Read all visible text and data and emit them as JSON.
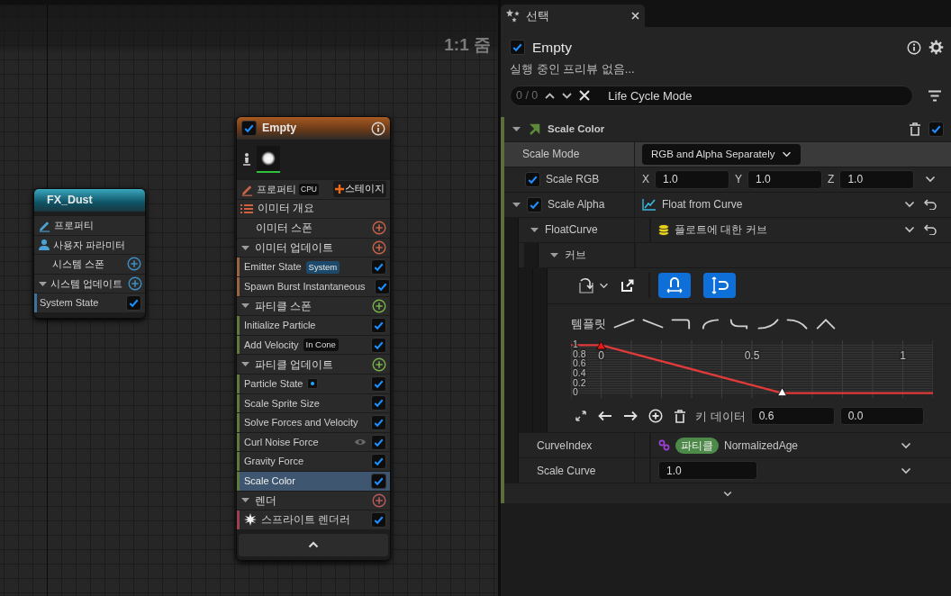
{
  "graph": {
    "zoom_label": "1:1 줌",
    "nodes": [
      {
        "kind": "system",
        "title": "FX_Dust",
        "rows": [
          {
            "kind": "properties",
            "label": "프로퍼티"
          },
          {
            "kind": "user_parameters",
            "label": "사용자 파라미터"
          },
          {
            "kind": "stage",
            "label": "시스템 스폰",
            "color": "#3d8ec4"
          },
          {
            "kind": "group",
            "label": "시스템 업데이트",
            "expanded": true,
            "color": "#3d8ec4"
          },
          {
            "kind": "module",
            "label": "System State",
            "checked": true,
            "selected": false,
            "color": "#3d7299"
          }
        ]
      },
      {
        "kind": "emitter",
        "title": "Empty",
        "checked": true,
        "rows": [
          {
            "kind": "properties",
            "label": "프로퍼티",
            "sim_target": "CPU",
            "add_button": "스테이지"
          },
          {
            "kind": "summary",
            "label": "이미터 개요"
          },
          {
            "kind": "stage",
            "label": "이미터 스폰",
            "color": "#c8634a"
          },
          {
            "kind": "group",
            "label": "이미터 업데이트",
            "expanded": true,
            "color": "#c8634a"
          },
          {
            "kind": "module",
            "label": "Emitter State",
            "badge": "System",
            "checked": true,
            "selected": false,
            "color": "#9a6440"
          },
          {
            "kind": "module",
            "label": "Spawn Burst Instantaneous",
            "checked": true,
            "selected": false,
            "color": "#9a6440"
          },
          {
            "kind": "group",
            "label": "파티클 스폰",
            "expanded": true,
            "color": "#7ab04a"
          },
          {
            "kind": "module",
            "label": "Initialize Particle",
            "checked": true,
            "selected": false,
            "color": "#5f7a3a"
          },
          {
            "kind": "module",
            "label": "Add Velocity",
            "badge": "In Cone",
            "checked": true,
            "selected": false,
            "color": "#5f7a3a"
          },
          {
            "kind": "group",
            "label": "파티클 업데이트",
            "expanded": true,
            "color": "#7ab04a"
          },
          {
            "kind": "dotmodule",
            "label": "Particle State",
            "checked": true,
            "selected": false,
            "color": "#5f7a3a"
          },
          {
            "kind": "module",
            "label": "Scale Sprite Size",
            "checked": true,
            "selected": false,
            "color": "#5f7a3a"
          },
          {
            "kind": "module",
            "label": "Solve Forces and Velocity",
            "checked": true,
            "selected": false,
            "color": "#5f7a3a"
          },
          {
            "kind": "eyemodule",
            "label": "Curl Noise Force",
            "checked": true,
            "selected": false,
            "color": "#5f7a3a"
          },
          {
            "kind": "module",
            "label": "Gravity Force",
            "checked": true,
            "selected": false,
            "color": "#5f7a3a"
          },
          {
            "kind": "module",
            "label": "Scale Color",
            "checked": true,
            "selected": true,
            "color": "#5f7a3a"
          },
          {
            "kind": "group",
            "label": "렌더",
            "expanded": true,
            "color": "#b85a5a"
          },
          {
            "kind": "renderer",
            "label": "스프라이트 렌더러",
            "checked": true,
            "color": "#9a4050"
          }
        ]
      }
    ]
  },
  "details": {
    "tab": {
      "label": "선택"
    },
    "emitter": {
      "checked": true,
      "title": "Empty",
      "status": "실행 중인 프리뷰 없음..."
    },
    "search": {
      "count": "0 / 0",
      "value": "Life Cycle Mode"
    },
    "module": {
      "title": "Scale Color",
      "expanded": true,
      "enabled": true,
      "properties": [
        {
          "kind": "dropdown",
          "label": "Scale Mode",
          "value": "RGB and Alpha Separately",
          "highlighted": true
        },
        {
          "kind": "vector",
          "label": "Scale RGB",
          "checked": true,
          "highlighted": false,
          "components": [
            {
              "axis": "X",
              "value": "1.0"
            },
            {
              "axis": "Y",
              "value": "1.0"
            },
            {
              "axis": "Z",
              "value": "1.0"
            }
          ]
        },
        {
          "kind": "dynamic_input",
          "label": "Scale Alpha",
          "checked": true,
          "expanded": true,
          "highlighted": false,
          "value": "Float from Curve",
          "children": [
            {
              "kind": "asset",
              "label": "FloatCurve",
              "expanded": true,
              "highlighted": false,
              "value": "플로트에 대한 커브",
              "children": [
                {
                  "kind": "curve",
                  "label": "커브",
                  "expanded": true,
                  "highlighted": false,
                  "toggles": [
                    {
                      "on": true
                    },
                    {
                      "on": true
                    }
                  ],
                  "templates_label": "템플릿",
                  "keys": [
                    {
                      "selected": true
                    },
                    {
                      "selected": false
                    }
                  ],
                  "key_label": "키 데이터",
                  "key_time": "0.6",
                  "key_value": "0.0",
                  "chart_data": {
                    "type": "line",
                    "x": [
                      -0.1,
                      0,
                      0.6,
                      1.1
                    ],
                    "series": [
                      {
                        "color": "#e03a3a",
                        "values": [
                          1,
                          1,
                          0,
                          0
                        ]
                      }
                    ],
                    "xlim": [
                      -0.1,
                      1.1
                    ],
                    "ylim": [
                      -0.1,
                      1.1
                    ],
                    "xticks": [
                      0,
                      0.5,
                      1
                    ],
                    "yticks": [
                      0,
                      0.2,
                      0.4,
                      0.6,
                      0.8,
                      1
                    ],
                    "grid": true
                  }
                }
              ]
            },
            {
              "kind": "linked",
              "label": "CurveIndex",
              "highlighted": false,
              "namespace": "파티클",
              "value": "NormalizedAge"
            },
            {
              "kind": "number",
              "label": "Scale Curve",
              "highlighted": false,
              "value": "1.0"
            }
          ]
        }
      ]
    }
  }
}
